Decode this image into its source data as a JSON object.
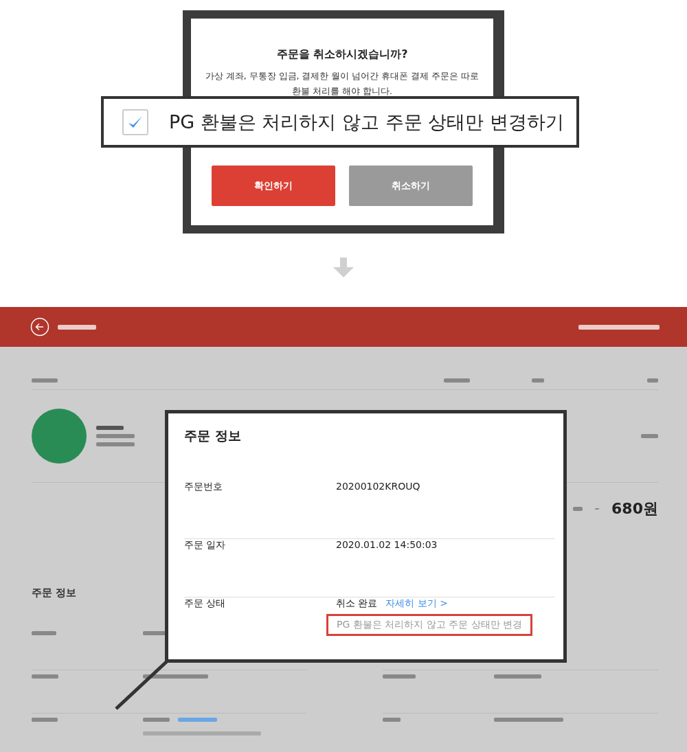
{
  "dialog": {
    "title": "주문을 취소하시겠습니까?",
    "message": "가상 계좌, 무통장 입금, 결제한 월이 넘어간 휴대폰 결제 주문은 따로 환불 처리를 해야 합니다.",
    "buttons": [
      {
        "label": "확인하기",
        "kind": "primary"
      },
      {
        "label": "취소하기",
        "kind": "secondary"
      }
    ]
  },
  "checkbox_callout": {
    "label": "PG 환불은 처리하지 않고 주문 상태만 변경하기",
    "checked": true
  },
  "order_page": {
    "total": "680원",
    "section_title": "주문 정보"
  },
  "zoom_panel": {
    "title": "주문 정보",
    "rows": [
      {
        "label": "주문번호",
        "value": "20200102KROUQ"
      },
      {
        "label": "주문 일자",
        "value": "2020.01.02 14:50:03"
      },
      {
        "label": "주문 상태",
        "value": "취소 완료",
        "link": "자세히 보기 >",
        "note": "PG 환불은 처리하지 않고 주문 상태만 변경"
      }
    ]
  }
}
